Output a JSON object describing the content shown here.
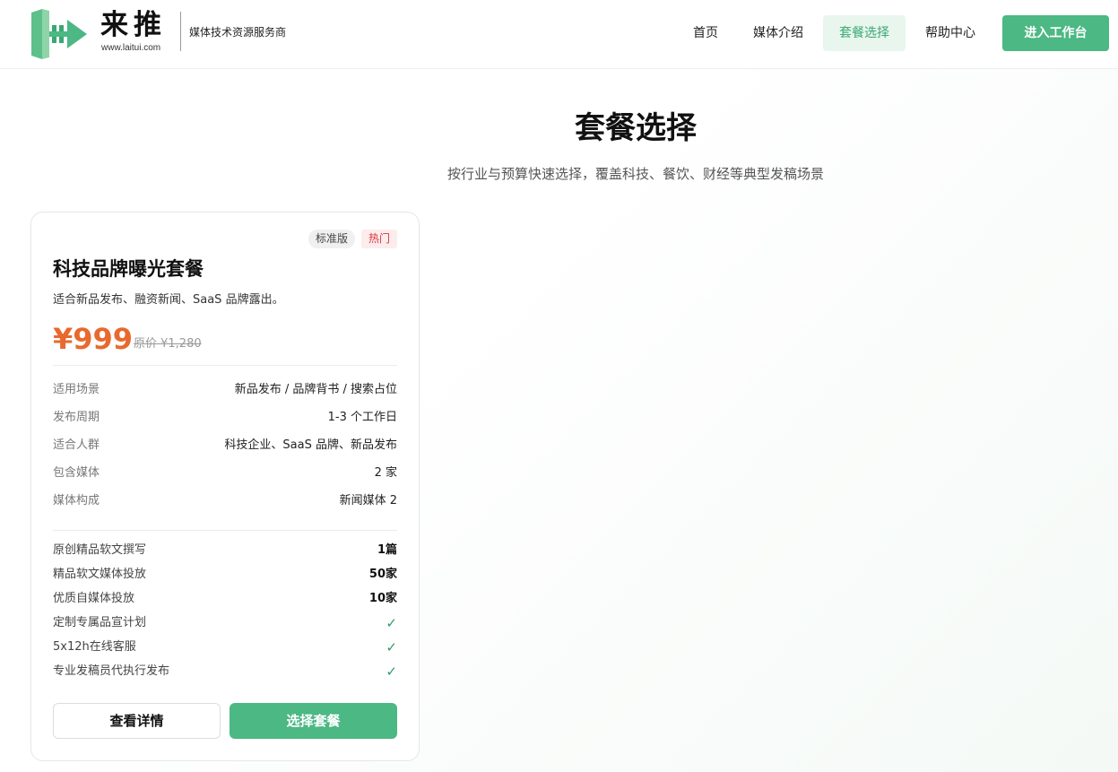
{
  "colors": {
    "brand": "#4cb883",
    "price": "#e8692e",
    "hot": "#d9363e",
    "check": "#2e9d63"
  },
  "header": {
    "logo_name": "来推",
    "logo_url": "www.laitui.com",
    "slogan": "媒体技术资源服务商",
    "logo_icon": "laitui-logo-icon",
    "nav": [
      {
        "label": "首页"
      },
      {
        "label": "媒体介绍"
      },
      {
        "label": "套餐选择",
        "active": true
      },
      {
        "label": "帮助中心"
      }
    ],
    "cta_label": "进入工作台"
  },
  "page": {
    "title": "套餐选择",
    "subtitle": "按行业与预算快速选择，覆盖科技、餐饮、财经等典型发稿场景"
  },
  "package": {
    "tags": [
      "标准版",
      "热门"
    ],
    "title": "科技品牌曝光套餐",
    "description": "适合新品发布、融资新闻、SaaS 品牌露出。",
    "price": "¥999",
    "original_price": "原价 ¥1,280",
    "info": [
      {
        "label": "适用场景",
        "value": "新品发布 / 品牌背书 / 搜索占位"
      },
      {
        "label": "发布周期",
        "value": "1-3 个工作日"
      },
      {
        "label": "适合人群",
        "value": "科技企业、SaaS 品牌、新品发布"
      },
      {
        "label": "包含媒体",
        "value": "2 家"
      },
      {
        "label": "媒体构成",
        "value": "新闻媒体 2"
      }
    ],
    "features": [
      {
        "label": "原创精品软文撰写",
        "value": "1篇"
      },
      {
        "label": "精品软文媒体投放",
        "value": "50家"
      },
      {
        "label": "优质自媒体投放",
        "value": "10家"
      },
      {
        "label": "定制专属品宣计划",
        "check": "✓"
      },
      {
        "label": "5x12h在线客服",
        "check": "✓"
      },
      {
        "label": "专业发稿员代执行发布",
        "check": "✓"
      }
    ],
    "detail_button": "查看详情",
    "select_button": "选择套餐"
  }
}
